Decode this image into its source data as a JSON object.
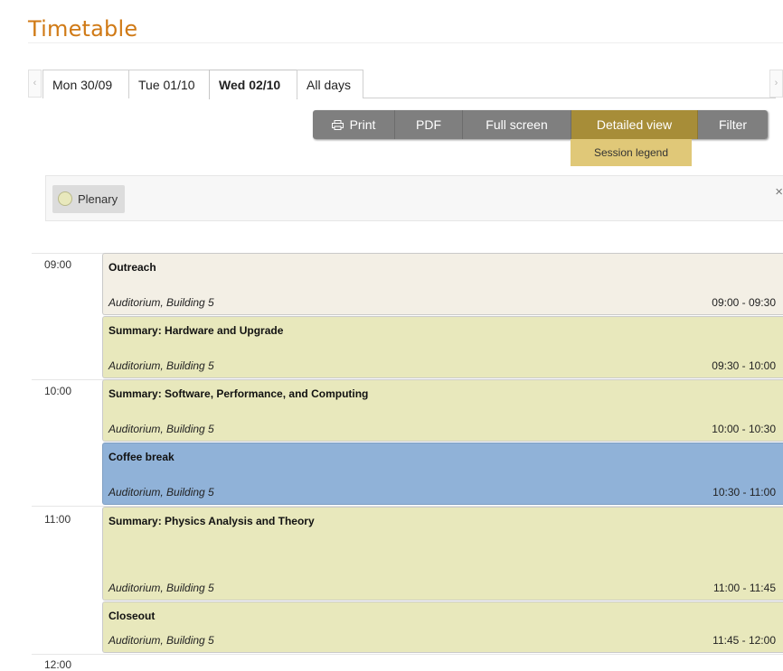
{
  "page": {
    "title": "Timetable"
  },
  "tabs": {
    "scroll_left_glyph": "‹",
    "scroll_right_glyph": "›",
    "items": [
      {
        "label": "Mon 30/09",
        "active": false
      },
      {
        "label": "Tue 01/10",
        "active": false
      },
      {
        "label": "Wed 02/10",
        "active": true
      },
      {
        "label": "All days",
        "active": false
      }
    ]
  },
  "toolbar": {
    "print": "Print",
    "pdf": "PDF",
    "full_screen": "Full screen",
    "detailed_view": "Detailed view",
    "filter": "Filter",
    "session_legend": "Session legend",
    "accent_color": "#a78d38"
  },
  "legend": {
    "items": [
      {
        "label": "Plenary",
        "color": "#e8e8bc"
      }
    ],
    "close_glyph": "×"
  },
  "hours": [
    "09:00",
    "10:00",
    "11:00",
    "12:00"
  ],
  "entries": [
    {
      "title": "Outreach",
      "room": "Auditorium, Building 5",
      "time": "09:00 - 09:30",
      "color": "#f3efe5"
    },
    {
      "title": "Summary: Hardware and Upgrade",
      "room": "Auditorium, Building 5",
      "time": "09:30 - 10:00",
      "color": "#e8e8bc"
    },
    {
      "title": "Summary: Software, Performance, and Computing",
      "room": "Auditorium, Building 5",
      "time": "10:00 - 10:30",
      "color": "#e8e8bc"
    },
    {
      "title": "Coffee break",
      "room": "Auditorium, Building 5",
      "time": "10:30 - 11:00",
      "color": "#90b2d8"
    },
    {
      "title": "Summary: Physics Analysis and Theory",
      "room": "Auditorium, Building 5",
      "time": "11:00 - 11:45",
      "color": "#e8e8bc"
    },
    {
      "title": "Closeout",
      "room": "Auditorium, Building 5",
      "time": "11:45 - 12:00",
      "color": "#e8e8bc"
    }
  ]
}
